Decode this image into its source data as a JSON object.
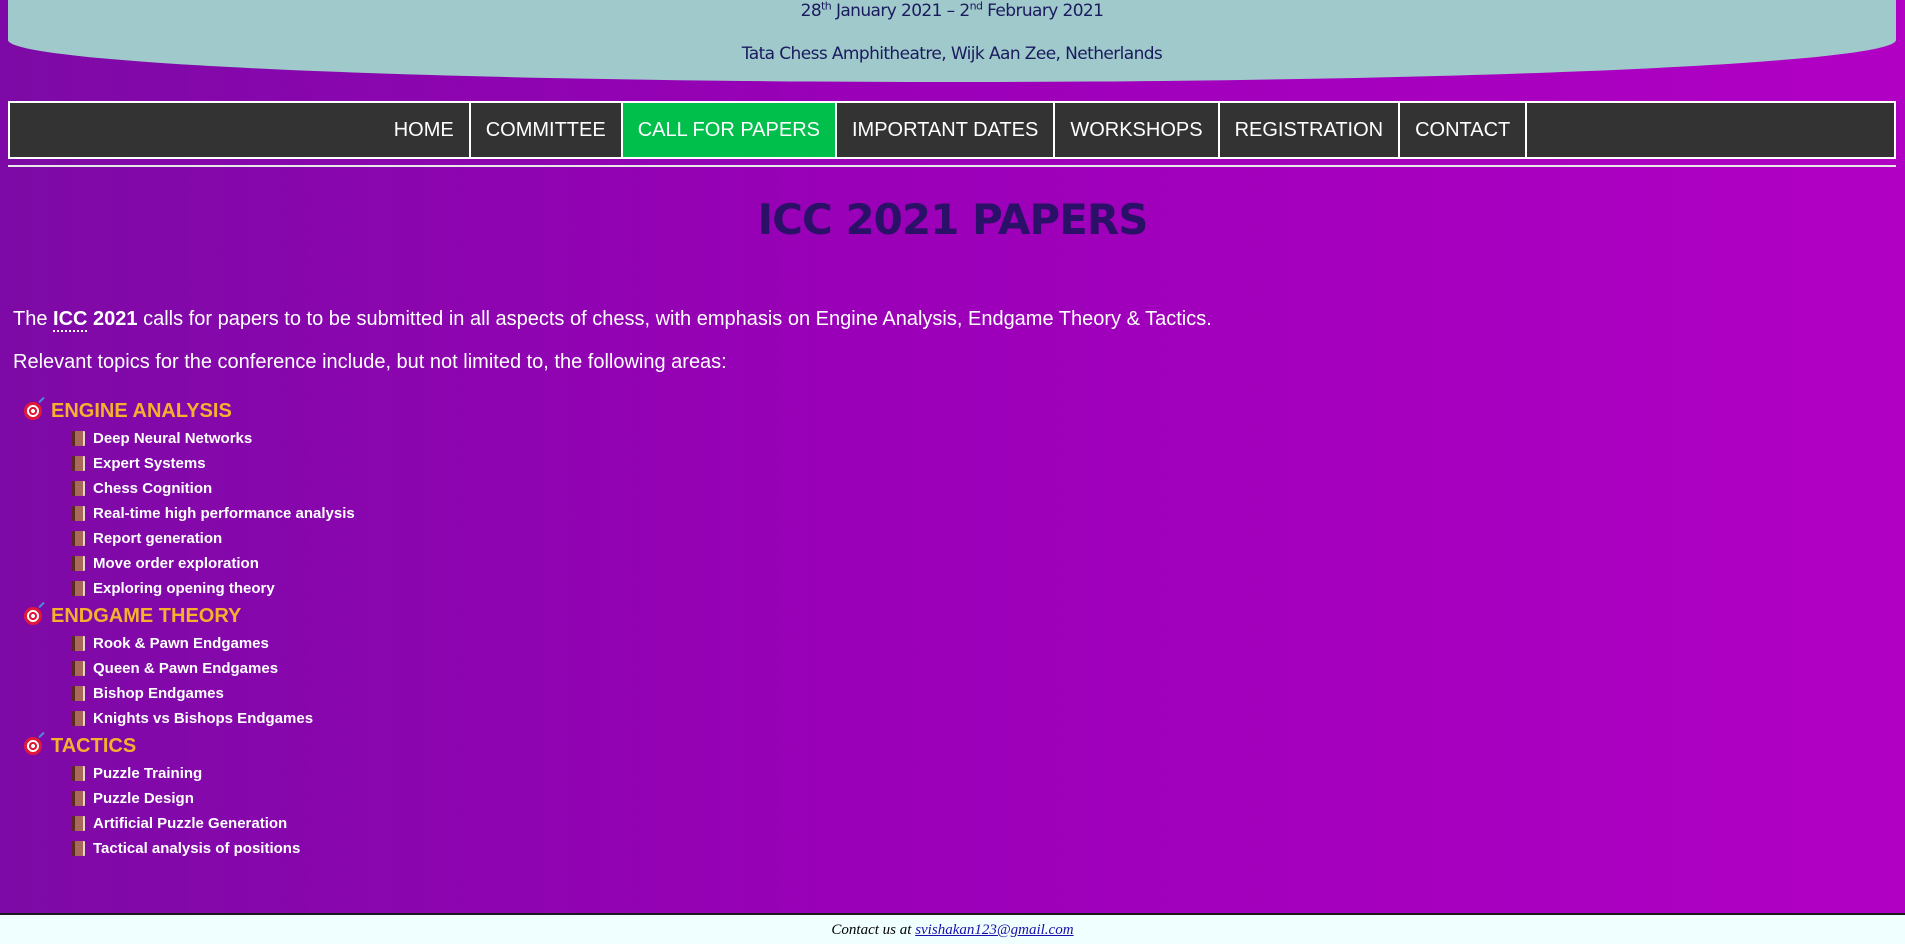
{
  "header": {
    "date_day_start": "28",
    "date_sup_start": "th",
    "date_mid": " January 2021 – 2",
    "date_sup_end": "nd",
    "date_end": " February 2021",
    "venue": "Tata Chess Amphitheatre, Wijk Aan Zee, Netherlands"
  },
  "nav": {
    "items": [
      {
        "label": "HOME"
      },
      {
        "label": "COMMITTEE"
      },
      {
        "label": "CALL FOR PAPERS"
      },
      {
        "label": "IMPORTANT DATES"
      },
      {
        "label": "WORKSHOPS"
      },
      {
        "label": "REGISTRATION"
      },
      {
        "label": "CONTACT"
      }
    ],
    "active": "CALL FOR PAPERS",
    "active_color": "#00c04b"
  },
  "main": {
    "title": "ICC 2021 PAPERS",
    "intro_prefix": "The ",
    "intro_abbr": "ICC",
    "intro_year": "2021",
    "intro_rest": " calls for papers to to be submitted in all aspects of chess, with emphasis on Engine Analysis, Endgame Theory & Tactics.",
    "topics_intro": "Relevant topics for the conference include, but not limited to, the following areas:",
    "categories": [
      {
        "name": "ENGINE ANALYSIS",
        "icon": "target-icon",
        "items": [
          "Deep Neural Networks",
          "Expert Systems",
          "Chess Cognition",
          "Real-time high performance analysis",
          "Report generation",
          "Move order exploration",
          "Exploring opening theory"
        ]
      },
      {
        "name": "ENDGAME THEORY",
        "icon": "target-icon",
        "items": [
          "Rook & Pawn Endgames",
          "Queen & Pawn Endgames",
          "Bishop Endgames",
          "Knights vs Bishops Endgames"
        ]
      },
      {
        "name": "TACTICS",
        "icon": "target-icon",
        "items": [
          "Puzzle Training",
          "Puzzle Design",
          "Artificial Puzzle Generation",
          "Tactical analysis of positions"
        ]
      }
    ]
  },
  "footer": {
    "text": "Contact us at ",
    "email": "svishakan123@gmail.com"
  },
  "colors": {
    "category": "#f5b02e",
    "banner": "#a0c9cb",
    "nav_bg": "#333333"
  }
}
